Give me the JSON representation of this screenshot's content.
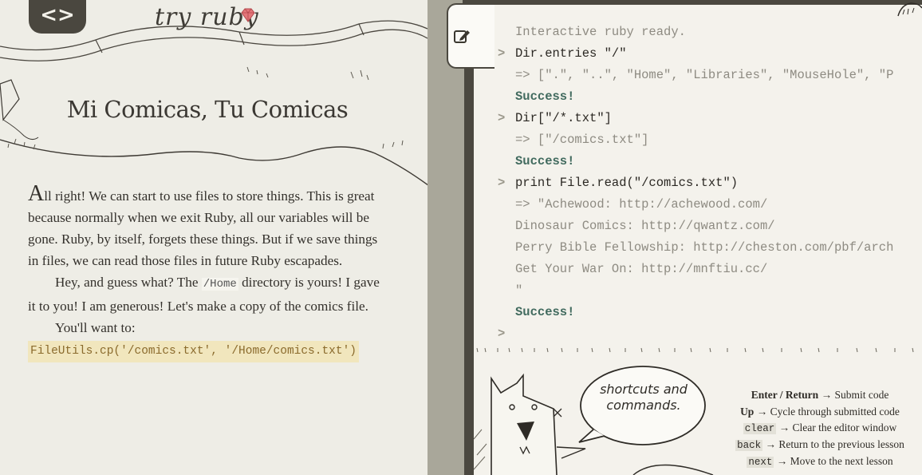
{
  "header": {
    "toggle_icon": "code-brackets-icon",
    "brand": "try ruby"
  },
  "lesson": {
    "title": "Mi Comicas, Tu Comicas",
    "p1_initial": "A",
    "p1_rest": "ll right! We can start to use files to store things. This is great because normally when we exit Ruby, all our variables will be gone. Ruby, by itself, forgets these things. But if we save things in files, we can read those files in future Ruby escapades.",
    "p2_before": "Hey, and guess what? The ",
    "p2_code": "/Home",
    "p2_after": " directory is yours! I gave it to you! I am generous! Let's make a copy of the comics file.",
    "p3": "You'll want to:",
    "snippet": "FileUtils.cp('/comics.txt', '/Home/comics.txt')"
  },
  "editor": {
    "edit_icon": "pencil-edit-icon",
    "prompt_symbol": ">",
    "lines": [
      {
        "kind": "info",
        "text": "Interactive ruby ready."
      },
      {
        "kind": "cmd",
        "text": "Dir.entries \"/\""
      },
      {
        "kind": "out",
        "text": "=> [\".\", \"..\", \"Home\", \"Libraries\", \"MouseHole\", \"P"
      },
      {
        "kind": "ok",
        "text": "Success!"
      },
      {
        "kind": "cmd",
        "text": "Dir[\"/*.txt\"]"
      },
      {
        "kind": "out",
        "text": "=> [\"/comics.txt\"]"
      },
      {
        "kind": "ok",
        "text": "Success!"
      },
      {
        "kind": "cmd",
        "text": "print File.read(\"/comics.txt\")"
      },
      {
        "kind": "out",
        "text": "=> \"Achewood: http://achewood.com/"
      },
      {
        "kind": "out",
        "text": "Dinosaur Comics: http://qwantz.com/"
      },
      {
        "kind": "out",
        "text": "Perry Bible Fellowship: http://cheston.com/pbf/arch"
      },
      {
        "kind": "out",
        "text": "Get Your War On: http://mnftiu.cc/"
      },
      {
        "kind": "out",
        "text": "\""
      },
      {
        "kind": "ok",
        "text": "Success!"
      },
      {
        "kind": "prompt",
        "text": ""
      }
    ]
  },
  "help": {
    "bubble": "shortcuts and commands.",
    "shortcuts": [
      {
        "key": "Enter / Return",
        "key_style": "bold",
        "desc": "Submit code"
      },
      {
        "key": "Up",
        "key_style": "bold",
        "desc": "Cycle through submitted code"
      },
      {
        "key": "clear",
        "key_style": "code",
        "desc": "Clear the editor window"
      },
      {
        "key": "back",
        "key_style": "code",
        "desc": "Return to the previous lesson"
      },
      {
        "key": "next",
        "key_style": "code",
        "desc": "Move to the next lesson"
      }
    ],
    "arrow": "→"
  },
  "colors": {
    "dark_bar": "#4b4840",
    "paper": "#eeede6",
    "success": "#426b5f",
    "snippet_bg": "#f1e6bd"
  }
}
